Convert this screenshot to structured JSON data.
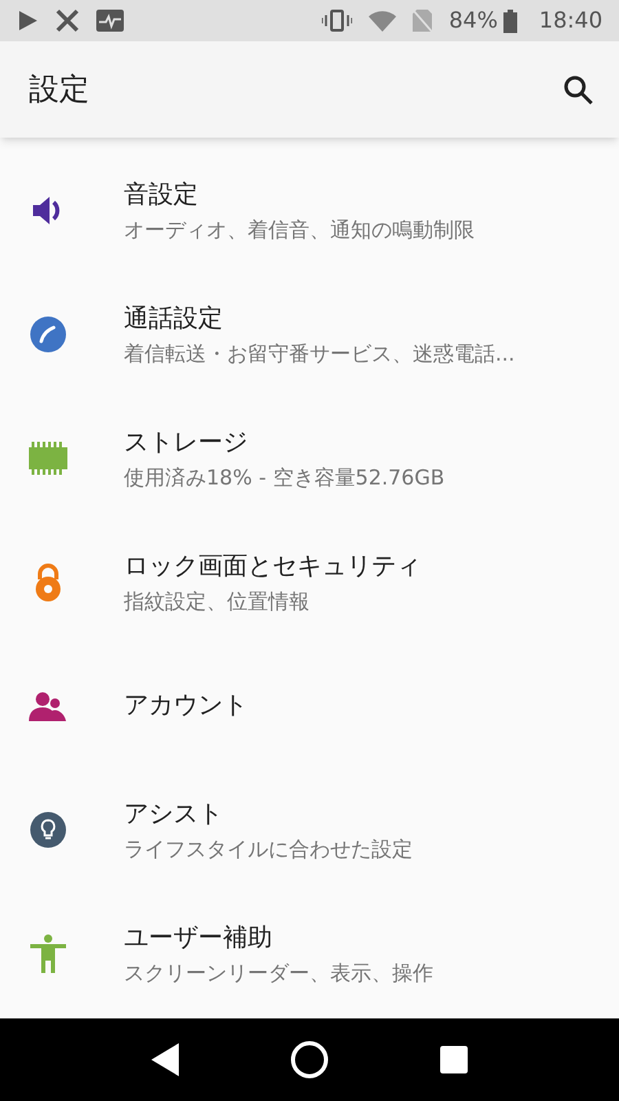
{
  "status_bar": {
    "battery_percent": "84%",
    "time": "18:40"
  },
  "app_bar": {
    "title": "設定"
  },
  "settings": [
    {
      "kind": "sound",
      "title": "音設定",
      "subtitle": "オーディオ、着信音、通知の鳴動制限"
    },
    {
      "kind": "call",
      "title": "通話設定",
      "subtitle": "着信転送・お留守番サービス、迷惑電話..."
    },
    {
      "kind": "storage",
      "title": "ストレージ",
      "subtitle": "使用済み18% - 空き容量52.76GB"
    },
    {
      "kind": "lock",
      "title": "ロック画面とセキュリティ",
      "subtitle": "指紋設定、位置情報"
    },
    {
      "kind": "account",
      "title": "アカウント"
    },
    {
      "kind": "assist",
      "title": "アシスト",
      "subtitle": "ライフスタイルに合わせた設定"
    },
    {
      "kind": "accessibility",
      "title": "ユーザー補助",
      "subtitle": "スクリーンリーダー、表示、操作"
    }
  ]
}
